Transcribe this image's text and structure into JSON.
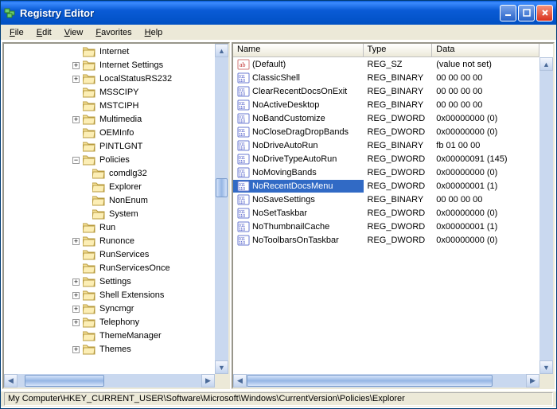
{
  "app": {
    "title": "Registry Editor"
  },
  "menu": [
    "File",
    "Edit",
    "View",
    "Favorites",
    "Help"
  ],
  "tree": [
    {
      "indent": 7,
      "exp": "none",
      "label": "Internet"
    },
    {
      "indent": 7,
      "exp": "plus",
      "label": "Internet Settings"
    },
    {
      "indent": 7,
      "exp": "plus",
      "label": "LocalStatusRS232"
    },
    {
      "indent": 7,
      "exp": "none",
      "label": "MSSCIPY"
    },
    {
      "indent": 7,
      "exp": "none",
      "label": "MSTCIPH"
    },
    {
      "indent": 7,
      "exp": "plus",
      "label": "Multimedia"
    },
    {
      "indent": 7,
      "exp": "none",
      "label": "OEMInfo"
    },
    {
      "indent": 7,
      "exp": "none",
      "label": "PINTLGNT"
    },
    {
      "indent": 7,
      "exp": "minus",
      "label": "Policies"
    },
    {
      "indent": 8,
      "exp": "none",
      "label": "comdlg32"
    },
    {
      "indent": 8,
      "exp": "none",
      "label": "Explorer"
    },
    {
      "indent": 8,
      "exp": "none",
      "label": "NonEnum"
    },
    {
      "indent": 8,
      "exp": "none",
      "label": "System"
    },
    {
      "indent": 7,
      "exp": "none",
      "label": "Run"
    },
    {
      "indent": 7,
      "exp": "plus",
      "label": "Runonce"
    },
    {
      "indent": 7,
      "exp": "none",
      "label": "RunServices"
    },
    {
      "indent": 7,
      "exp": "none",
      "label": "RunServicesOnce"
    },
    {
      "indent": 7,
      "exp": "plus",
      "label": "Settings"
    },
    {
      "indent": 7,
      "exp": "plus",
      "label": "Shell Extensions"
    },
    {
      "indent": 7,
      "exp": "plus",
      "label": "Syncmgr"
    },
    {
      "indent": 7,
      "exp": "plus",
      "label": "Telephony"
    },
    {
      "indent": 7,
      "exp": "none",
      "label": "ThemeManager"
    },
    {
      "indent": 7,
      "exp": "plus",
      "label": "Themes"
    }
  ],
  "columns": {
    "name": "Name",
    "type": "Type",
    "data": "Data"
  },
  "col_widths": {
    "name": 170,
    "type": 90,
    "data": 140
  },
  "values": [
    {
      "icon": "sz",
      "name": "(Default)",
      "type": "REG_SZ",
      "data": "(value not set)",
      "sel": false
    },
    {
      "icon": "bin",
      "name": "ClassicShell",
      "type": "REG_BINARY",
      "data": "00 00 00 00",
      "sel": false
    },
    {
      "icon": "bin",
      "name": "ClearRecentDocsOnExit",
      "type": "REG_BINARY",
      "data": "00 00 00 00",
      "sel": false
    },
    {
      "icon": "bin",
      "name": "NoActiveDesktop",
      "type": "REG_BINARY",
      "data": "00 00 00 00",
      "sel": false
    },
    {
      "icon": "bin",
      "name": "NoBandCustomize",
      "type": "REG_DWORD",
      "data": "0x00000000 (0)",
      "sel": false
    },
    {
      "icon": "bin",
      "name": "NoCloseDragDropBands",
      "type": "REG_DWORD",
      "data": "0x00000000 (0)",
      "sel": false
    },
    {
      "icon": "bin",
      "name": "NoDriveAutoRun",
      "type": "REG_BINARY",
      "data": "fb 01 00 00",
      "sel": false
    },
    {
      "icon": "bin",
      "name": "NoDriveTypeAutoRun",
      "type": "REG_DWORD",
      "data": "0x00000091 (145)",
      "sel": false
    },
    {
      "icon": "bin",
      "name": "NoMovingBands",
      "type": "REG_DWORD",
      "data": "0x00000000 (0)",
      "sel": false
    },
    {
      "icon": "bin",
      "name": "NoRecentDocsMenu",
      "type": "REG_DWORD",
      "data": "0x00000001 (1)",
      "sel": true
    },
    {
      "icon": "bin",
      "name": "NoSaveSettings",
      "type": "REG_BINARY",
      "data": "00 00 00 00",
      "sel": false
    },
    {
      "icon": "bin",
      "name": "NoSetTaskbar",
      "type": "REG_DWORD",
      "data": "0x00000000 (0)",
      "sel": false
    },
    {
      "icon": "bin",
      "name": "NoThumbnailCache",
      "type": "REG_DWORD",
      "data": "0x00000001 (1)",
      "sel": false
    },
    {
      "icon": "bin",
      "name": "NoToolbarsOnTaskbar",
      "type": "REG_DWORD",
      "data": "0x00000000 (0)",
      "sel": false
    }
  ],
  "status": "My Computer\\HKEY_CURRENT_USER\\Software\\Microsoft\\Windows\\CurrentVersion\\Policies\\Explorer"
}
